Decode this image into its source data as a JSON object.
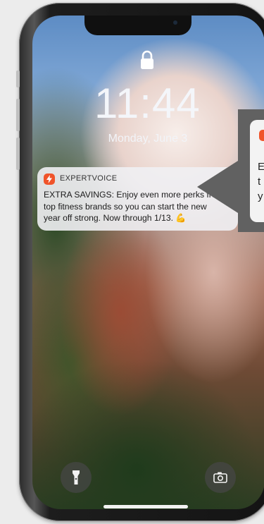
{
  "lockscreen": {
    "time": "11:44",
    "date": "Monday, June 3"
  },
  "notification": {
    "app_name": "EXPERTVOICE",
    "body": "EXTRA SAVINGS: Enjoy even more perks from\ntop fitness brands so you can start the new\nyear off strong. Now through 1/13. 💪",
    "accent_color": "#f0542a"
  },
  "callout_preview": {
    "lines": [
      "E",
      "t",
      "y"
    ]
  },
  "icons": {
    "lock": "lock-icon",
    "flashlight": "flashlight-icon",
    "camera": "camera-icon",
    "app": "expertvoice-bolt-icon"
  }
}
